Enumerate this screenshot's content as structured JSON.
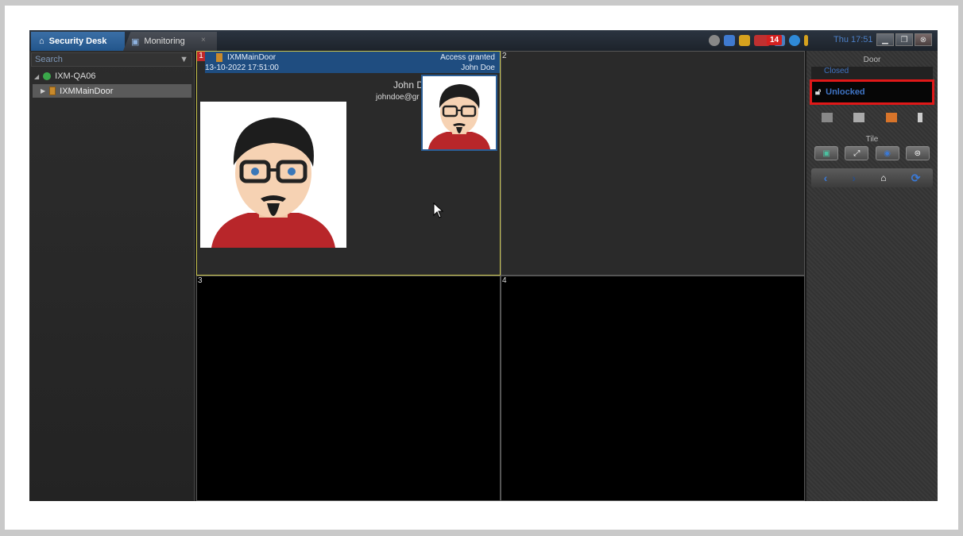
{
  "tabs": [
    {
      "label": "Security Desk"
    },
    {
      "label": "Monitoring"
    }
  ],
  "titlebar": {
    "close_tab": "×",
    "clock": "Thu 17:51",
    "alarm_count": "14"
  },
  "left_panel": {
    "search_placeholder": "Search",
    "tree": [
      {
        "label": "IXM-QA06"
      },
      {
        "label": "IXMMainDoor"
      }
    ]
  },
  "tiles": {
    "t1": {
      "number": "1",
      "door": "IXMMainDoor",
      "timestamp": "13-10-2022 17:51:00",
      "status": "Access granted",
      "cardholder": "John Doe",
      "card_name": "John D",
      "card_email": "johndoe@gr"
    },
    "t2": {
      "number": "2"
    },
    "t3": {
      "number": "3"
    },
    "t4": {
      "number": "4"
    }
  },
  "right_panel": {
    "door_title": "Door",
    "closed_label": "Closed",
    "unlocked_label": "Unlocked",
    "tile_title": "Tile"
  },
  "colors": {
    "accent": "#3f74c4",
    "highlight_box": "#e01818",
    "selected_tile_border": "#c8c34a"
  }
}
